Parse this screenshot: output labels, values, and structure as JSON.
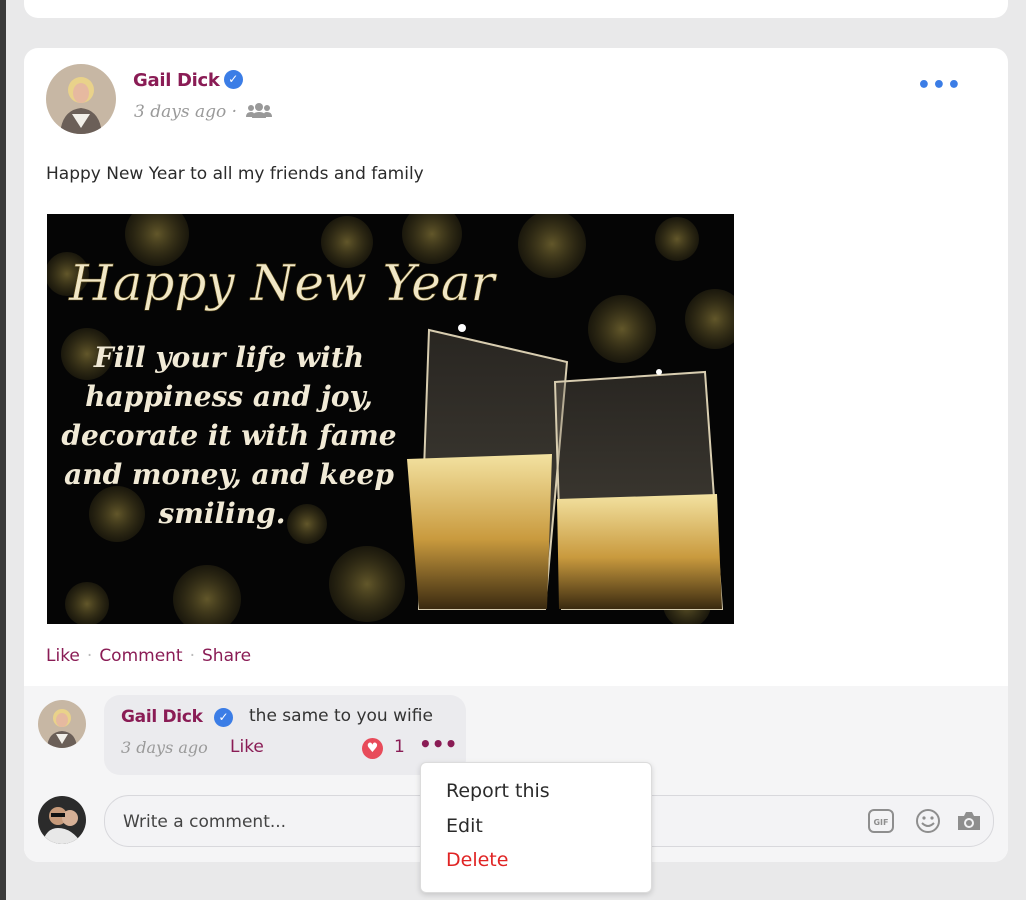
{
  "post": {
    "author": "Gail Dick",
    "time": "3 days ago",
    "separator": "·",
    "text": "Happy New Year to all my friends and family",
    "image": {
      "headline": "Happy New Year",
      "lines": [
        "Fill your life with",
        "happiness and joy,",
        "decorate it with fame",
        "and money, and keep",
        "smiling."
      ]
    },
    "actions": {
      "like": "Like",
      "comment": "Comment",
      "share": "Share",
      "sep": "·"
    }
  },
  "comment": {
    "author": "Gail Dick",
    "text": "the same to you wifie",
    "time": "3 days ago",
    "like": "Like",
    "reaction_count": "1"
  },
  "composer": {
    "placeholder": "Write a comment..."
  },
  "menu": {
    "items": [
      "Report this",
      "Edit",
      "Delete"
    ]
  },
  "colors": {
    "brand": "#8a1c55",
    "verified": "#3b7de6",
    "danger": "#e02424"
  }
}
